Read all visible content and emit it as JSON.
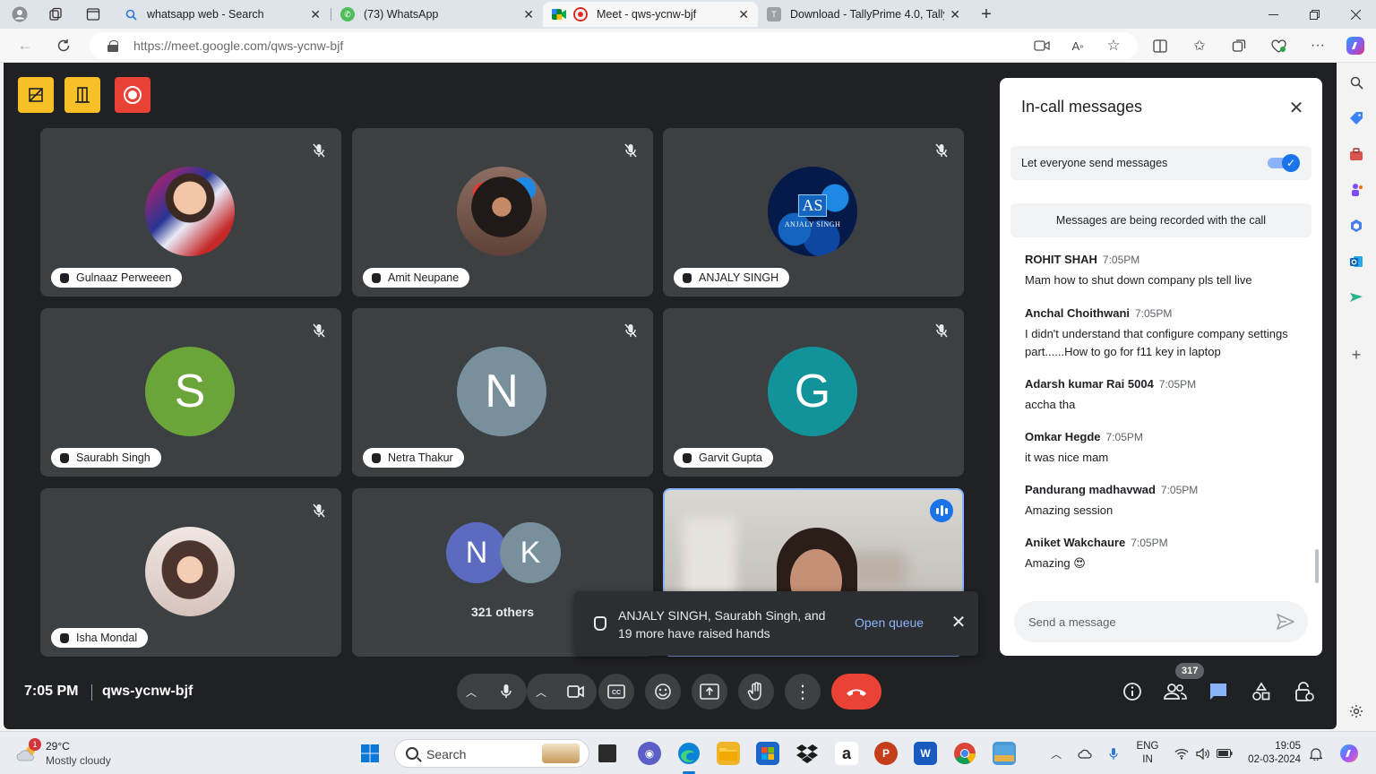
{
  "browser": {
    "tabs": [
      {
        "title": "whatsapp web - Search"
      },
      {
        "title": "(73) WhatsApp"
      },
      {
        "title": "Meet - qws-ycnw-bjf"
      },
      {
        "title": "Download - TallyPrime 4.0, TallyPrime"
      }
    ],
    "url_host": "https://meet.google.com",
    "url_path": "/qws-ycnw-bjf"
  },
  "participants": [
    {
      "name": "Gulnaaz Perweeen",
      "initial": "",
      "color": "#c2185b"
    },
    {
      "name": "Amit Neupane",
      "initial": "",
      "color": "#6d5a4e"
    },
    {
      "name": "ANJALY SINGH",
      "initial": "AS",
      "avatar_text": "ANJALY SINGH",
      "color": "#0d47a1"
    },
    {
      "name": "Saurabh Singh",
      "initial": "S",
      "color": "#6ba539"
    },
    {
      "name": "Netra Thakur",
      "initial": "N",
      "color": "#78909c"
    },
    {
      "name": "Garvit Gupta",
      "initial": "G",
      "color": "#12939a"
    },
    {
      "name": "Isha Mondal",
      "initial": "",
      "color": "#a1887f"
    }
  ],
  "others": {
    "initials": [
      "N",
      "K"
    ],
    "colors": [
      "#5c6bc0",
      "#78909c"
    ],
    "label": "321 others"
  },
  "toast": {
    "text": "ANJALY SINGH, Saurabh Singh, and 19 more have raised hands",
    "link": "Open queue"
  },
  "chat": {
    "title": "In-call messages",
    "permission_label": "Let everyone send messages",
    "permission_enabled": true,
    "recording_note": "Messages are being recorded with the call",
    "messages": [
      {
        "sender": "ROHIT SHAH",
        "time": "7:05PM",
        "text": "Mam how to shut down company pls tell live"
      },
      {
        "sender": "Anchal Choithwani",
        "time": "7:05PM",
        "text": "I didn't understand that configure company settings part......How to go for f11 key in laptop"
      },
      {
        "sender": "Adarsh kumar Rai 5004",
        "time": "7:05PM",
        "text": "accha tha"
      },
      {
        "sender": "Omkar Hegde",
        "time": "7:05PM",
        "text": "it was nice  mam"
      },
      {
        "sender": "Pandurang madhavwad",
        "time": "7:05PM",
        "text": "Amazing session"
      },
      {
        "sender": "Aniket Wakchaure",
        "time": "7:05PM",
        "text": "Amazing 😍"
      }
    ],
    "input_placeholder": "Send a message"
  },
  "bottom": {
    "time": "7:05 PM",
    "meeting_code": "qws-ycnw-bjf",
    "people_count": "317"
  },
  "taskbar": {
    "temperature": "29°C",
    "weather": "Mostly cloudy",
    "weather_badge": "1",
    "search": "Search",
    "lang_top": "ENG",
    "lang_bottom": "IN",
    "time": "19:05",
    "date": "02-03-2024"
  }
}
